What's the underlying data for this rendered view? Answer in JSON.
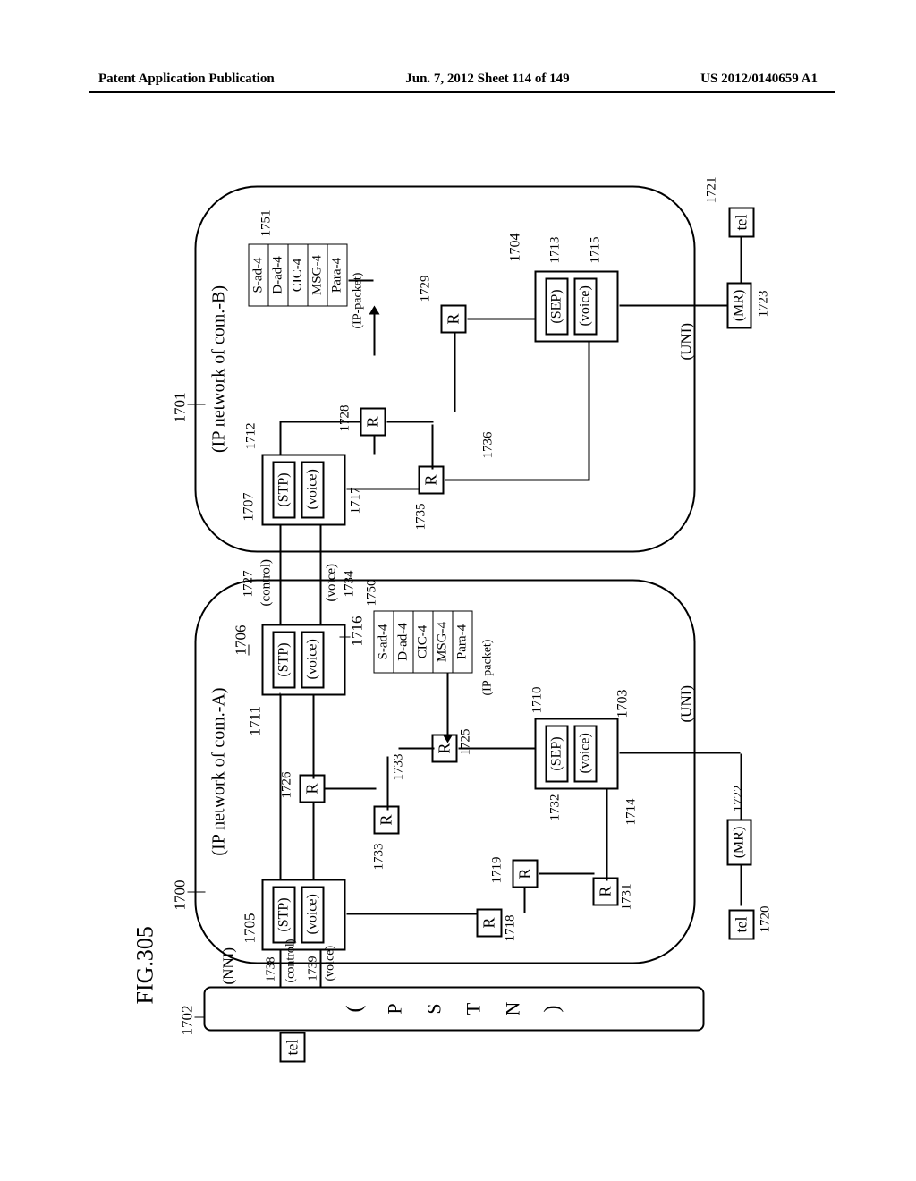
{
  "header": {
    "left": "Patent Application Publication",
    "center": "Jun. 7, 2012  Sheet 114 of 149",
    "right": "US 2012/0140659 A1"
  },
  "figure": {
    "title": "FIG.305",
    "pstn_letters": [
      "(",
      "P",
      "S",
      "T",
      "N",
      ")"
    ],
    "tel_label": "tel",
    "mr_label": "(MR)",
    "uni_label": "(UNI)",
    "nni_label": "(NNI)",
    "control_label": "(control)",
    "voice_label": "(voice)",
    "stp_label": "(STP)",
    "sep_label": "(SEP)",
    "router_label": "R",
    "ip_packet_label": "(IP-packet)",
    "cloudA_label": "(IP network   of   com.-A)",
    "cloudB_label": "(IP network   of   com.-B)"
  },
  "chart_data": {
    "type": "diagram",
    "title": "FIG.305",
    "networks": [
      {
        "id": 1700,
        "label": "IP network of com.-A"
      },
      {
        "id": 1701,
        "label": "IP network of com.-B"
      },
      {
        "id": 1702,
        "label": "PSTN"
      }
    ],
    "interfaces": [
      {
        "label": "NNI",
        "between": [
          "PSTN",
          "IP network of com.-A"
        ]
      },
      {
        "label": "UNI",
        "between": [
          "IP network of com.-A",
          "tel/MR 1720/1722"
        ]
      },
      {
        "label": "UNI",
        "between": [
          "IP network of com.-B",
          "tel/MR 1721/1723"
        ]
      }
    ],
    "links": [
      {
        "label": "control",
        "id": 1727,
        "between": [
          1706,
          1707
        ]
      },
      {
        "label": "voice",
        "id": 1734,
        "between": [
          1716,
          1717
        ]
      },
      {
        "label": "control",
        "id": 1738,
        "between": [
          1702,
          1705
        ]
      },
      {
        "label": "voice",
        "id": 1739,
        "between": [
          1702,
          1718
        ]
      }
    ],
    "nodes": [
      {
        "id": 1705,
        "type": "STP-box",
        "contains": [
          1711,
          1716
        ]
      },
      {
        "id": 1706,
        "type": "STP-box",
        "contains": [
          1711,
          1716
        ]
      },
      {
        "id": 1707,
        "type": "STP-box",
        "contains": [
          1712,
          1717
        ]
      },
      {
        "id": 1703,
        "type": "SEP-box",
        "contains": [
          1710,
          1714
        ]
      },
      {
        "id": 1704,
        "type": "SEP-box",
        "contains": [
          1713,
          1715
        ]
      },
      {
        "id": 1711,
        "type": "STP"
      },
      {
        "id": 1712,
        "type": "STP"
      },
      {
        "id": 1710,
        "type": "SEP"
      },
      {
        "id": 1713,
        "type": "SEP"
      },
      {
        "id": 1714,
        "type": "voice"
      },
      {
        "id": 1715,
        "type": "voice"
      },
      {
        "id": 1716,
        "type": "voice"
      },
      {
        "id": 1717,
        "type": "voice"
      },
      {
        "id": 1718,
        "type": "R"
      },
      {
        "id": 1719,
        "type": "R"
      },
      {
        "id": 1725,
        "type": "R"
      },
      {
        "id": 1726,
        "type": "R"
      },
      {
        "id": 1728,
        "type": "R"
      },
      {
        "id": 1729,
        "type": "R"
      },
      {
        "id": 1731,
        "type": "R"
      },
      {
        "id": 1732,
        "type": "R"
      },
      {
        "id": 1733,
        "type": "R"
      },
      {
        "id": 1735,
        "type": "R"
      },
      {
        "id": 1736,
        "type": "R"
      },
      {
        "id": 1720,
        "type": "tel"
      },
      {
        "id": 1721,
        "type": "tel"
      },
      {
        "id": 1722,
        "type": "MR"
      },
      {
        "id": 1723,
        "type": "MR"
      }
    ],
    "ip_packets": [
      {
        "id": 1750,
        "fields": [
          "S-ad-4",
          "D-ad-4",
          "CIC-4",
          "MSG-4",
          "Para-4"
        ],
        "in": "com.-A"
      },
      {
        "id": 1751,
        "fields": [
          "S-ad-4",
          "D-ad-4",
          "CIC-4",
          "MSG-4",
          "Para-4"
        ],
        "in": "com.-B"
      }
    ],
    "reference_numerals": [
      1700,
      1701,
      1702,
      1703,
      1704,
      1705,
      1706,
      1707,
      1710,
      1711,
      1712,
      1713,
      1714,
      1715,
      1716,
      1717,
      1718,
      1719,
      1720,
      1721,
      1722,
      1723,
      1725,
      1726,
      1727,
      1728,
      1729,
      1731,
      1732,
      1733,
      1734,
      1735,
      1736,
      1738,
      1739,
      1750,
      1751
    ]
  },
  "packet": {
    "f1": "S-ad-4",
    "f2": "D-ad-4",
    "f3": "CIC-4",
    "f4": "MSG-4",
    "f5": "Para-4"
  },
  "refs": {
    "r1700": "1700",
    "r1701": "1701",
    "r1702": "1702",
    "r1703": "1703",
    "r1704": "1704",
    "r1705": "1705",
    "r1706": "1706",
    "r1707": "1707",
    "r1710": "1710",
    "r1711": "1711",
    "r1712": "1712",
    "r1713": "1713",
    "r1714": "1714",
    "r1715": "1715",
    "r1716": "1716",
    "r1717": "1717",
    "r1718": "1718",
    "r1719": "1719",
    "r1720": "1720",
    "r1721": "1721",
    "r1722": "1722",
    "r1723": "1723",
    "r1725": "1725",
    "r1726": "1726",
    "r1727": "1727",
    "r1728": "1728",
    "r1729": "1729",
    "r1731": "1731",
    "r1732": "1732",
    "r1733": "1733",
    "r1734": "1734",
    "r1735": "1735",
    "r1736": "1736",
    "r1738": "1738",
    "r1739": "1739",
    "r1750": "1750",
    "r1751": "1751"
  }
}
